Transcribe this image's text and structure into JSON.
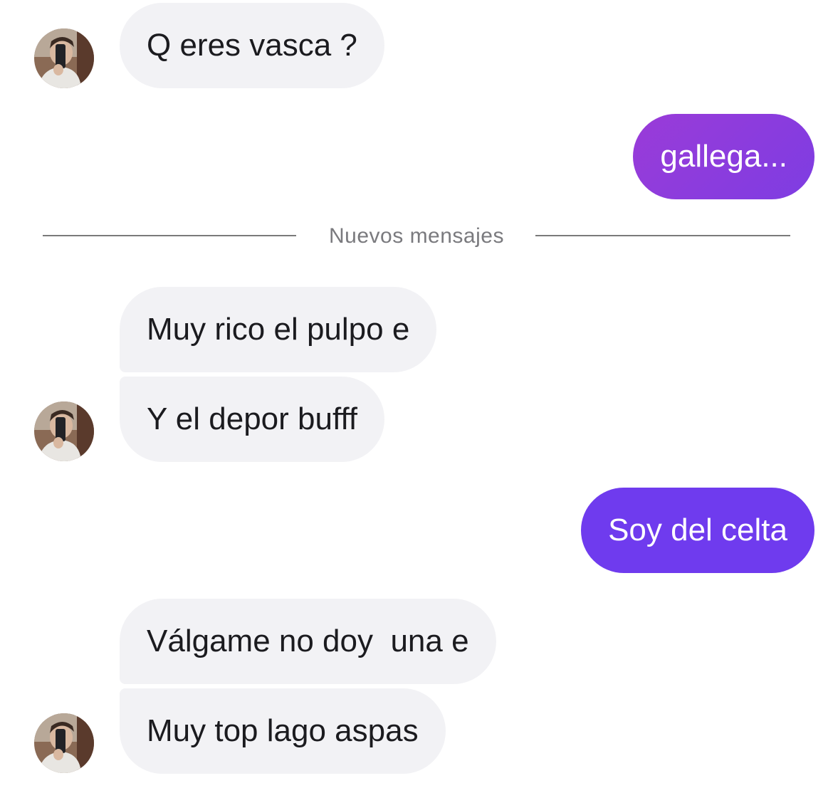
{
  "colors": {
    "incoming_bubble": "#f2f2f5",
    "outgoing_gradient_start": "#8e3bdc",
    "outgoing_gradient_end": "#7a3de6",
    "outgoing_solid": "#6d3ef0",
    "divider": "#7a7a7a"
  },
  "divider": {
    "label": "Nuevos mensajes"
  },
  "messages": [
    {
      "direction": "in",
      "text": "Q eres vasca ?",
      "avatar": "avatar-photo"
    },
    {
      "direction": "out",
      "text": "gallega..."
    },
    {
      "direction": "in",
      "text": "Muy rico el pulpo e"
    },
    {
      "direction": "in",
      "text": "Y el depor bufff",
      "avatar": "avatar-photo"
    },
    {
      "direction": "out",
      "text": "Soy del celta"
    },
    {
      "direction": "in",
      "text": "Válgame no doy  una e"
    },
    {
      "direction": "in",
      "text": "Muy top lago aspas",
      "avatar": "avatar-photo"
    }
  ]
}
